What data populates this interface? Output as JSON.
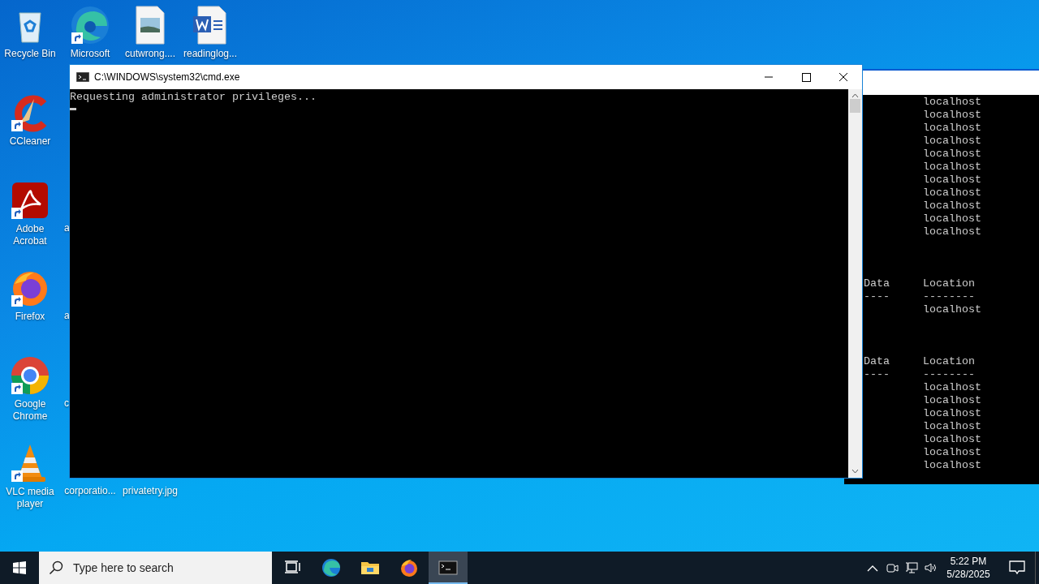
{
  "desktop_columns": [
    [
      {
        "label": "Recycle Bin",
        "kind": "recycle",
        "shortcut": false
      },
      {
        "label": "CCleaner",
        "kind": "ccleaner",
        "shortcut": true
      },
      {
        "label": "Adobe Acrobat",
        "kind": "acrobat",
        "shortcut": true
      },
      {
        "label": "Firefox",
        "kind": "firefox",
        "shortcut": true
      },
      {
        "label": "Google Chrome",
        "kind": "chrome",
        "shortcut": true
      },
      {
        "label": "VLC media player",
        "kind": "vlc",
        "shortcut": true
      }
    ],
    [
      {
        "label": "Microsoft",
        "kind": "edge",
        "shortcut": true
      },
      {
        "kind": "empty"
      },
      {
        "label": "a",
        "kind": "covered"
      },
      {
        "label": "a",
        "kind": "covered"
      },
      {
        "label": "c",
        "kind": "covered"
      },
      {
        "label": "corporatio...",
        "kind": "covered-file"
      }
    ],
    [
      {
        "label": "cutwrong....",
        "kind": "image-file",
        "shortcut": false
      },
      {
        "kind": "empty"
      },
      {
        "kind": "empty"
      },
      {
        "kind": "empty"
      },
      {
        "kind": "empty"
      },
      {
        "label": "privatetry.jpg",
        "kind": "covered-file"
      }
    ],
    [
      {
        "label": "readinglog...",
        "kind": "word-file",
        "shortcut": false
      }
    ]
  ],
  "background_console": {
    "blocks": [
      {
        "rows": [
          {
            "right": "localhost"
          },
          {
            "right": "localhost"
          },
          {
            "right": "localhost"
          },
          {
            "right": "localhost"
          },
          {
            "right": "localhost"
          },
          {
            "right": "localhost"
          },
          {
            "right": "localhost"
          },
          {
            "right": "localhost"
          },
          {
            "right": "localhost"
          },
          {
            "right": "localhost"
          },
          {
            "right": "localhost"
          }
        ]
      },
      {
        "rows": [
          {
            "left": "Data",
            "right": "Location"
          },
          {
            "left": "----",
            "right": "--------"
          },
          {
            "right": "localhost"
          }
        ]
      },
      {
        "rows": [
          {
            "left": "Data",
            "right": "Location"
          },
          {
            "left": "----",
            "right": "--------"
          },
          {
            "right": "localhost"
          },
          {
            "right": "localhost"
          },
          {
            "right": "localhost"
          },
          {
            "right": "localhost"
          },
          {
            "right": "localhost"
          },
          {
            "right": "localhost"
          },
          {
            "right": "localhost"
          }
        ]
      }
    ]
  },
  "cmd_window": {
    "title": "C:\\WINDOWS\\system32\\cmd.exe",
    "lines": [
      "Requesting administrator privileges..."
    ]
  },
  "taskbar": {
    "search": {
      "placeholder": "Type here to search"
    },
    "apps": [
      {
        "kind": "task-view",
        "selected": false
      },
      {
        "kind": "edge",
        "selected": false
      },
      {
        "kind": "explorer",
        "selected": false
      },
      {
        "kind": "firefox",
        "selected": false
      },
      {
        "kind": "terminal",
        "selected": true
      }
    ],
    "tray": [
      {
        "kind": "chevron"
      },
      {
        "kind": "camera"
      },
      {
        "kind": "network"
      },
      {
        "kind": "volume"
      }
    ],
    "time": "5:22 PM",
    "date": "5/28/2025"
  }
}
